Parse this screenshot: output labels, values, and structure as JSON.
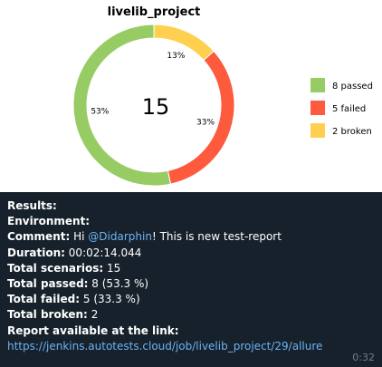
{
  "chart_data": {
    "type": "pie",
    "title": "livelib_project",
    "center_value": "15",
    "slices": [
      {
        "label": "8 passed",
        "value": 8,
        "percent_label": "53%",
        "color": "#97cc64"
      },
      {
        "label": "5 failed",
        "value": 5,
        "percent_label": "33%",
        "color": "#fd5a3e"
      },
      {
        "label": "2 broken",
        "value": 2,
        "percent_label": "13%",
        "color": "#ffd050"
      }
    ],
    "legend": "right"
  },
  "message": {
    "results_label": "Results:",
    "environment_label": "Environment:",
    "comment_label": "Comment:",
    "comment_greeting": "Hi",
    "comment_mention": "@Didarphin",
    "comment_text": "! This is new test-report",
    "duration_label": "Duration:",
    "duration_value": "00:02:14.044",
    "scenarios_label": "Total scenarios:",
    "scenarios_value": "15",
    "passed_label": "Total passed:",
    "passed_value": "8 (53.3 %)",
    "failed_label": "Total failed:",
    "failed_value": "5 (33.3 %)",
    "broken_label": "Total broken:",
    "broken_value": "2",
    "report_label": "Report available at the link:",
    "report_link": "https://jenkins.autotests.cloud/job/livelib_project/29/allure",
    "time": "0:32"
  },
  "colors": {
    "background": "#17212b",
    "link": "#6ab3f3",
    "timestamp": "#6d7f8f"
  }
}
